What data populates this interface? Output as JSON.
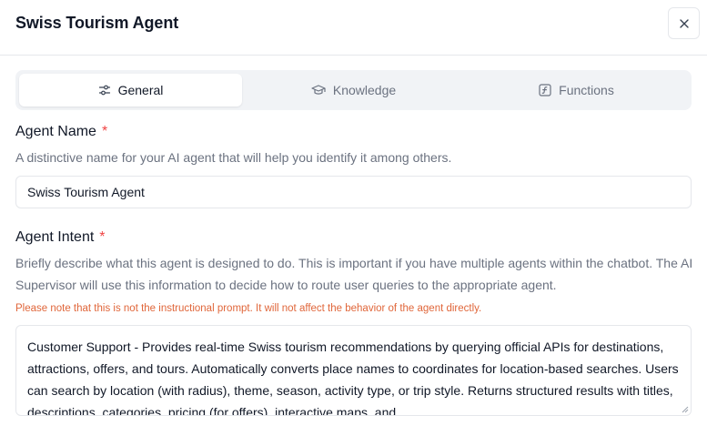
{
  "dialog": {
    "title": "Swiss Tourism Agent"
  },
  "tabs": [
    {
      "label": "General",
      "icon": "sliders-icon",
      "active": true
    },
    {
      "label": "Knowledge",
      "icon": "graduation-cap-icon",
      "active": false
    },
    {
      "label": "Functions",
      "icon": "function-icon",
      "active": false
    }
  ],
  "agent_name": {
    "label": "Agent Name",
    "required_mark": "*",
    "help": "A distinctive name for your AI agent that will help you identify it among others.",
    "value": "Swiss Tourism Agent"
  },
  "agent_intent": {
    "label": "Agent Intent",
    "required_mark": "*",
    "help": "Briefly describe what this agent is designed to do. This is important if you have multiple agents within the chatbot. The AI Supervisor will use this information to decide how to route user queries to the appropriate agent.",
    "warning": "Please note that this is not the instructional prompt. It will not affect the behavior of the agent directly.",
    "value": "Customer Support - Provides real-time Swiss tourism recommendations by querying official APIs for destinations, attractions, offers, and tours. Automatically converts place names to coordinates for location-based searches. Users can search by location (with radius), theme, season, activity type, or trip style. Returns structured results with titles, descriptions, categories, pricing (for offers), interactive maps, and"
  },
  "colors": {
    "accent_required": "#ef4444",
    "warning": "#e0663a",
    "tab_bar_bg": "#f1f3f6"
  }
}
